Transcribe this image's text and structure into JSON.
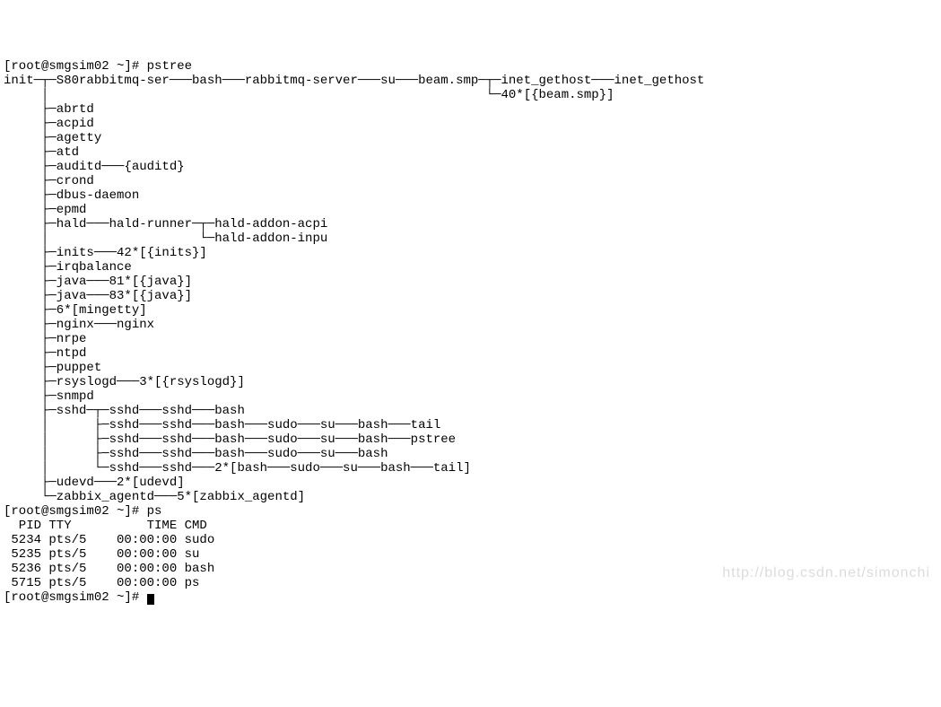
{
  "prompt1": "[root@smgsim02 ~]# ",
  "cmd1": "pstree",
  "tree": [
    "init─┬─S80rabbitmq-ser───bash───rabbitmq-server───su───beam.smp─┬─inet_gethost───inet_gethost",
    "     │                                                          └─40*[{beam.smp}]",
    "     ├─abrtd",
    "     ├─acpid",
    "     ├─agetty",
    "     ├─atd",
    "     ├─auditd───{auditd}",
    "     ├─crond",
    "     ├─dbus-daemon",
    "     ├─epmd",
    "     ├─hald───hald-runner─┬─hald-addon-acpi",
    "     │                    └─hald-addon-inpu",
    "     ├─inits───42*[{inits}]",
    "     ├─irqbalance",
    "     ├─java───81*[{java}]",
    "     ├─java───83*[{java}]",
    "     ├─6*[mingetty]",
    "     ├─nginx───nginx",
    "     ├─nrpe",
    "     ├─ntpd",
    "     ├─puppet",
    "     ├─rsyslogd───3*[{rsyslogd}]",
    "     ├─snmpd",
    "     ├─sshd─┬─sshd───sshd───bash",
    "     │      ├─sshd───sshd───bash───sudo───su───bash───tail",
    "     │      ├─sshd───sshd───bash───sudo───su───bash───pstree",
    "     │      ├─sshd───sshd───bash───sudo───su───bash",
    "     │      └─sshd───sshd───2*[bash───sudo───su───bash───tail]",
    "     ├─udevd───2*[udevd]",
    "     └─zabbix_agentd───5*[zabbix_agentd]"
  ],
  "prompt2": "[root@smgsim02 ~]# ",
  "cmd2": "ps",
  "ps_header": "  PID TTY          TIME CMD",
  "ps_rows": [
    " 5234 pts/5    00:00:00 sudo",
    " 5235 pts/5    00:00:00 su",
    " 5236 pts/5    00:00:00 bash",
    " 5715 pts/5    00:00:00 ps"
  ],
  "prompt3": "[root@smgsim02 ~]# ",
  "watermark": "http://blog.csdn.net/simonchi"
}
